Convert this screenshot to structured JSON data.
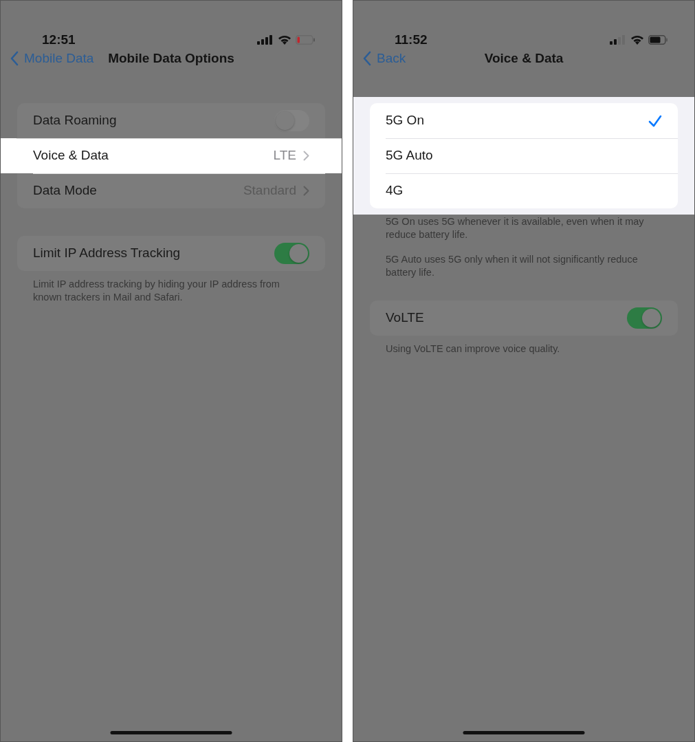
{
  "screens": [
    {
      "status_bar": {
        "time": "12:51",
        "battery_low": true
      },
      "nav": {
        "back": "Mobile Data",
        "title": "Mobile Data Options"
      },
      "groups": [
        {
          "highlighted": false,
          "rows": [
            {
              "kind": "toggle",
              "label": "Data Roaming",
              "on": false,
              "highlighted": false
            },
            {
              "kind": "detail",
              "label": "Voice & Data",
              "value": "LTE",
              "highlighted": true
            },
            {
              "kind": "detail",
              "label": "Data Mode",
              "value": "Standard",
              "highlighted": false
            }
          ]
        },
        {
          "highlighted": false,
          "rows": [
            {
              "kind": "toggle",
              "label": "Limit IP Address Tracking",
              "on": true,
              "highlighted": false
            }
          ],
          "footer": [
            "Limit IP address tracking by hiding your IP address from known trackers in Mail and Safari."
          ]
        }
      ]
    },
    {
      "status_bar": {
        "time": "11:52",
        "battery_low": false
      },
      "nav": {
        "back": "Back",
        "title": "Voice & Data"
      },
      "groups": [
        {
          "highlighted": true,
          "rows": [
            {
              "kind": "option",
              "label": "5G On",
              "selected": true,
              "highlighted": false
            },
            {
              "kind": "option",
              "label": "5G Auto",
              "selected": false,
              "highlighted": false
            },
            {
              "kind": "option",
              "label": "4G",
              "selected": false,
              "highlighted": false
            }
          ],
          "footer": [
            "5G On uses 5G whenever it is available, even when it may reduce battery life.",
            "5G Auto uses 5G only when it will not significantly reduce battery life."
          ]
        },
        {
          "highlighted": false,
          "rows": [
            {
              "kind": "toggle",
              "label": "VoLTE",
              "on": true,
              "highlighted": false
            }
          ],
          "footer": [
            "Using VoLTE can improve voice quality."
          ]
        }
      ]
    }
  ]
}
